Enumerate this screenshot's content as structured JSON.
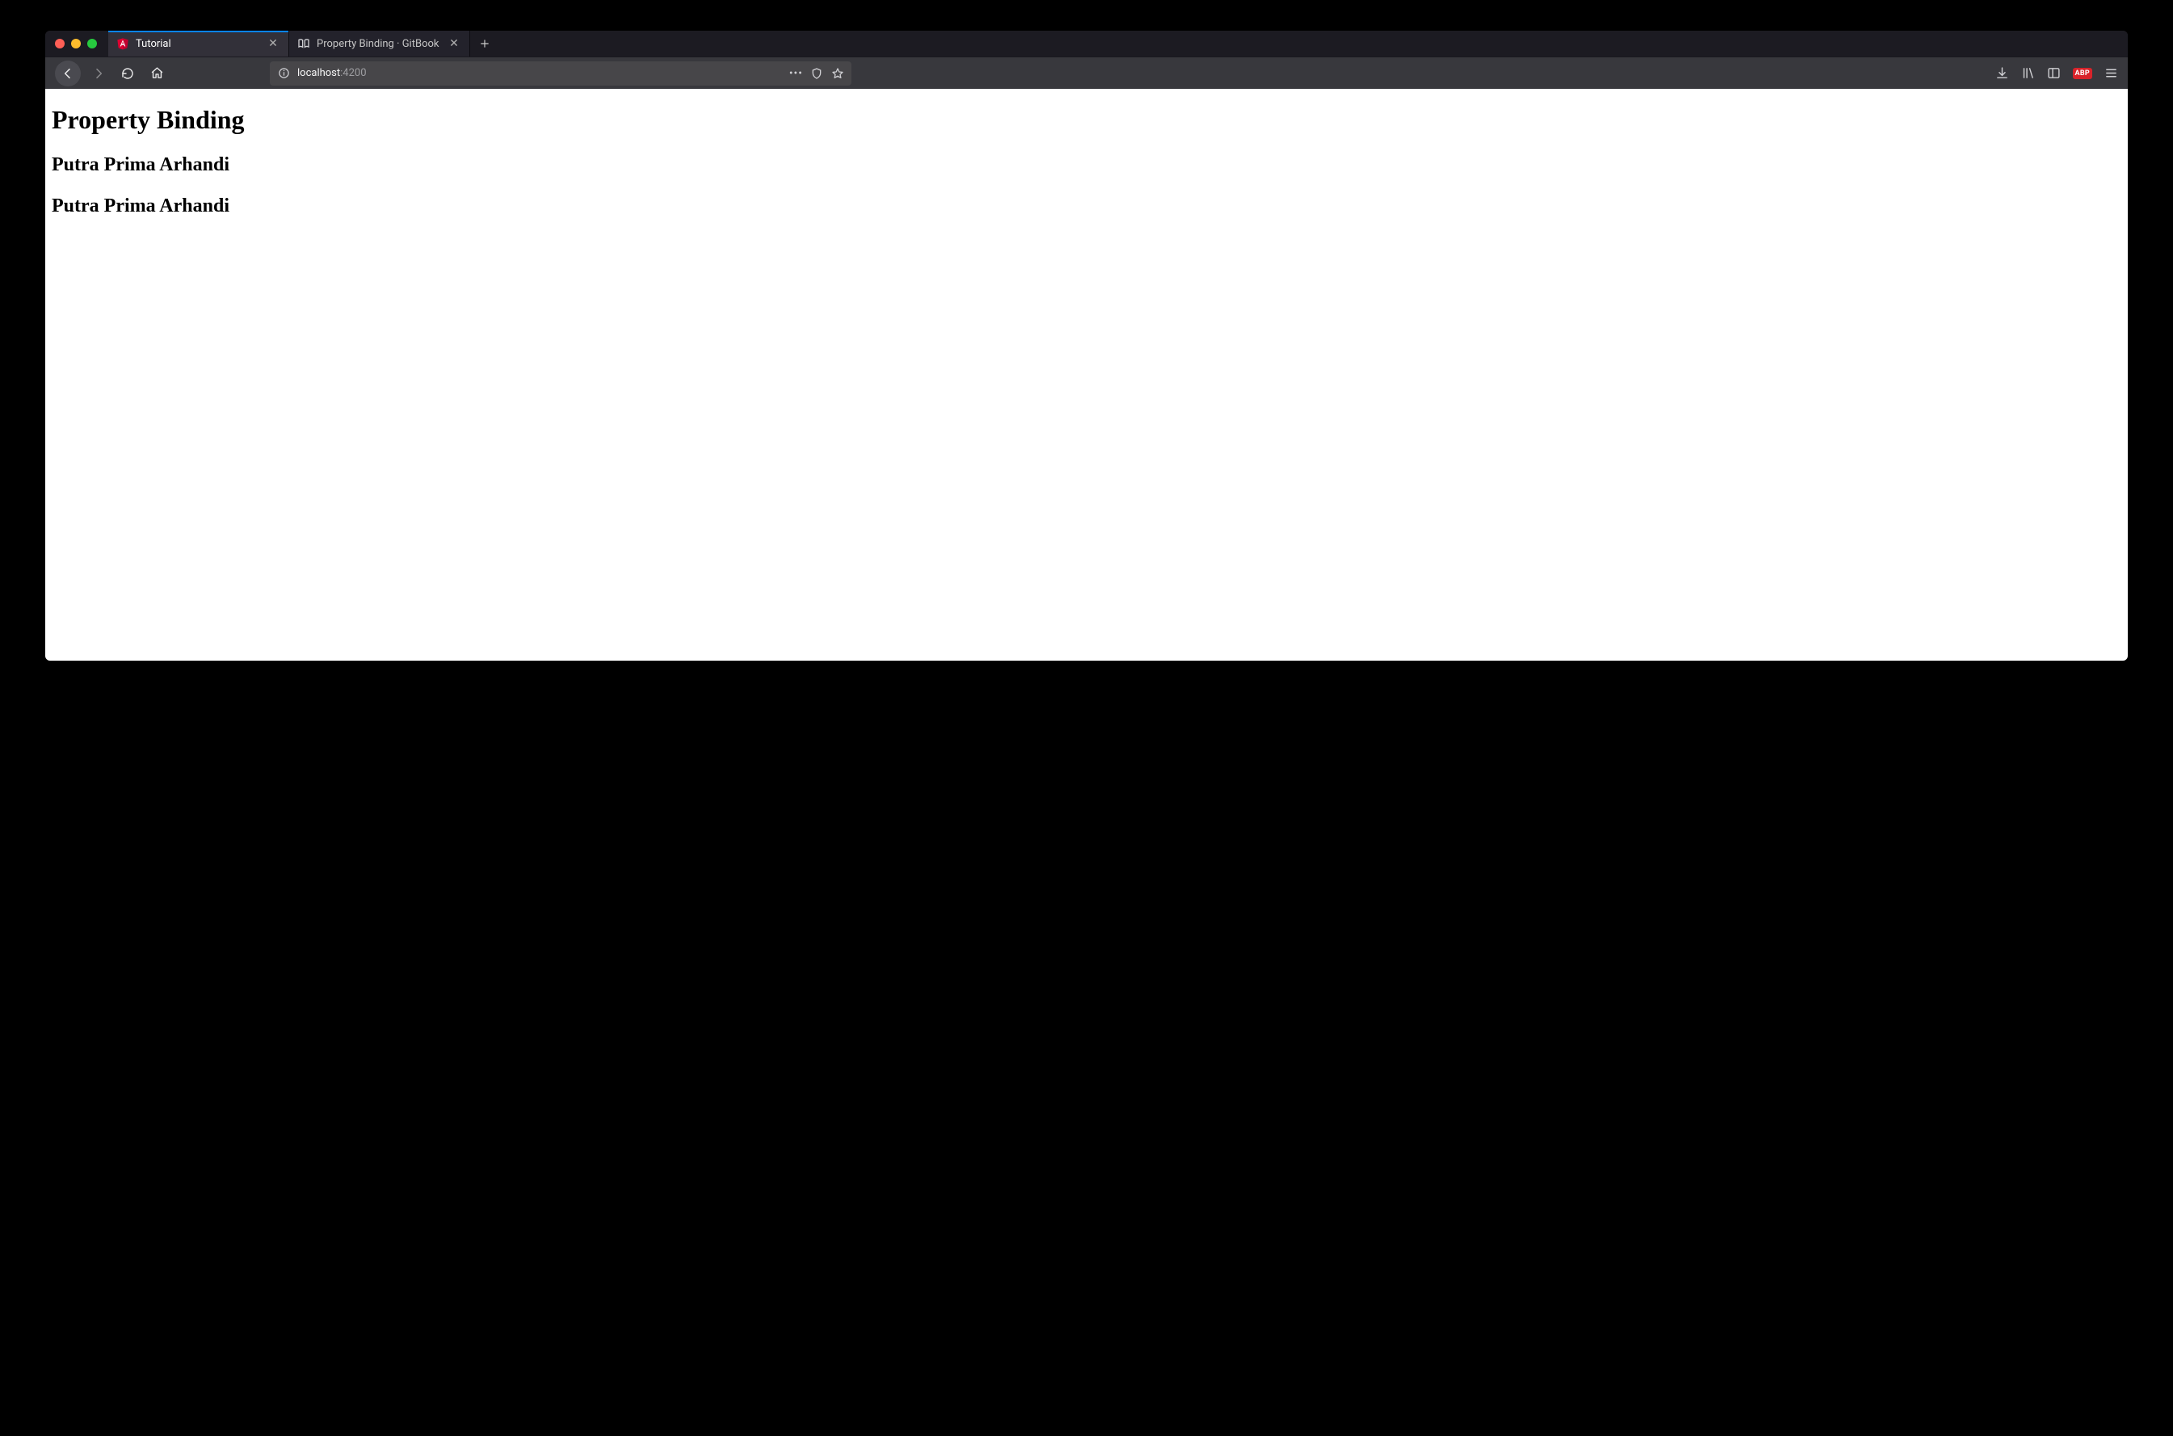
{
  "tabs": [
    {
      "title": "Tutorial",
      "active": true,
      "icon": "angular"
    },
    {
      "title": "Property Binding · GitBook",
      "active": false,
      "icon": "gitbook"
    }
  ],
  "url": {
    "host": "localhost",
    "port": ":4200"
  },
  "badges": {
    "abp": "ABP"
  },
  "page": {
    "heading": "Property Binding",
    "sub1": "Putra Prima Arhandi",
    "sub2": "Putra Prima Arhandi"
  }
}
